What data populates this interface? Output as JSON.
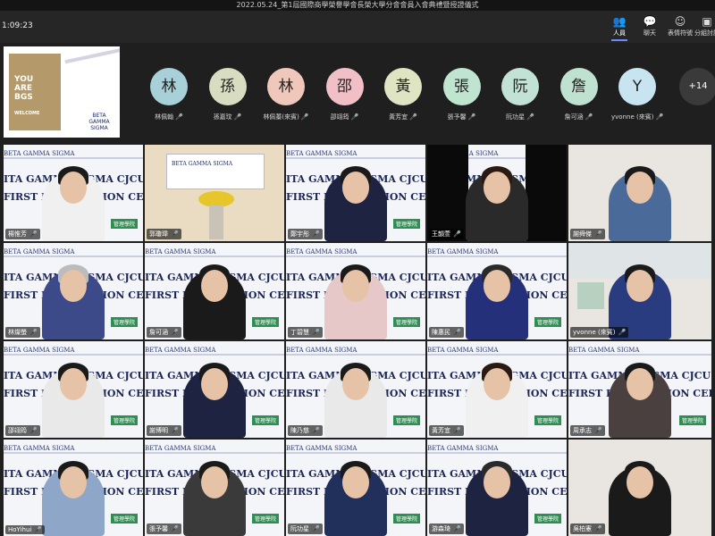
{
  "window": {
    "title": "2022.05.24_第1屆國際商學榮譽學會長榮大學分會會員入會典禮暨授證儀式"
  },
  "toolbar": {
    "timer": "1:09:23",
    "tools": [
      {
        "label": "人員",
        "icon": "people-icon",
        "active": true
      },
      {
        "label": "聊天",
        "icon": "chat-icon",
        "active": false
      },
      {
        "label": "表情符號",
        "icon": "emoji-icon",
        "active": false
      },
      {
        "label": "分組討論",
        "icon": "breakout-icon",
        "active": false
      }
    ]
  },
  "share": {
    "poster_text": "YOU ARE BGS",
    "poster_welcome": "WELCOME",
    "brand": "BETA GAMMA SIGMA"
  },
  "strip": {
    "participants": [
      {
        "initial": "林",
        "name": "林佩翰",
        "color": "#a8d0d8"
      },
      {
        "initial": "孫",
        "name": "孫嘉玟",
        "color": "#d8dcc0"
      },
      {
        "initial": "林",
        "name": "林佩蓁(來賓)",
        "color": "#f0c7bb"
      },
      {
        "initial": "邵",
        "name": "邵翊筠",
        "color": "#f0c0c6"
      },
      {
        "initial": "黃",
        "name": "黃芳宜",
        "color": "#dfe4c2"
      },
      {
        "initial": "張",
        "name": "張予馨",
        "color": "#bfe4cf"
      },
      {
        "initial": "阮",
        "name": "阮功星",
        "color": "#c2e2d6"
      },
      {
        "initial": "詹",
        "name": "詹可涵",
        "color": "#bfe2d0"
      },
      {
        "initial": "Y",
        "name": "yvonne (來賓)",
        "color": "#c8e4f0"
      }
    ],
    "more": "+14"
  },
  "banner": {
    "brand": "BETA GAMMA SIGMA",
    "chapter": "ITA GAMMA SIGMA CJCU CHAPTER",
    "ceremony": "FIRST RECOGNITION CEREMONY",
    "logo": "管理學院"
  },
  "grid": [
    {
      "name": "楊惟芳",
      "kind": "banner",
      "shirt": "#f0f0f0",
      "hair": "#1a1a1a"
    },
    {
      "name": "郭瓊瑋",
      "kind": "stage"
    },
    {
      "name": "鄭宇彤",
      "kind": "banner",
      "shirt": "#1d2340",
      "hair": "#1a1a1a"
    },
    {
      "name": "王韻萱",
      "kind": "narrow",
      "shirt": "#2a2a2a",
      "hair": "#2a1a12"
    },
    {
      "name": "謝舜傑",
      "kind": "plain",
      "shirt": "#4a6a9a",
      "hair": "#1a1a1a"
    },
    {
      "name": "林燦螢",
      "kind": "banner",
      "shirt": "#3d4a8a",
      "hair": "#bcbcbc"
    },
    {
      "name": "詹可涵",
      "kind": "banner",
      "shirt": "#1a1a1a",
      "hair": "#1a1a1a"
    },
    {
      "name": "丁碧慧",
      "kind": "banner",
      "shirt": "#e7c8c8",
      "hair": "#1a1a1a"
    },
    {
      "name": "陳惠民",
      "kind": "banner",
      "shirt": "#25307a",
      "hair": "#2a2a2a"
    },
    {
      "name": "yvonne (來賓)",
      "kind": "office",
      "shirt": "#2a3c80",
      "hair": "#1a1a1a"
    },
    {
      "name": "邵翊筠",
      "kind": "banner",
      "shirt": "#e9e9e9",
      "hair": "#1a1a1a"
    },
    {
      "name": "謝博明",
      "kind": "banner",
      "shirt": "#1d2340",
      "hair": "#1a1a1a"
    },
    {
      "name": "陳乃慈",
      "kind": "banner",
      "shirt": "#e9e9e9",
      "hair": "#1a1a1a"
    },
    {
      "name": "黃芳宜",
      "kind": "banner",
      "shirt": "#f0f0f0",
      "hair": "#2a1a12"
    },
    {
      "name": "周承志",
      "kind": "banner",
      "shirt": "#4a4040",
      "hair": "#1a1a1a"
    },
    {
      "name": "HoYihui",
      "kind": "banner",
      "shirt": "#8ea6c8",
      "hair": "#1a1a1a"
    },
    {
      "name": "張予馨",
      "kind": "banner",
      "shirt": "#3a3a3a",
      "hair": "#1a1a1a"
    },
    {
      "name": "阮功星",
      "kind": "banner",
      "shirt": "#20305a",
      "hair": "#1a1a1a"
    },
    {
      "name": "游森琦",
      "kind": "banner",
      "shirt": "#1d2340",
      "hair": "#2a2a2a"
    },
    {
      "name": "吳柏憲",
      "kind": "plain",
      "shirt": "#1a1a1a",
      "hair": "#1a1a1a"
    }
  ]
}
